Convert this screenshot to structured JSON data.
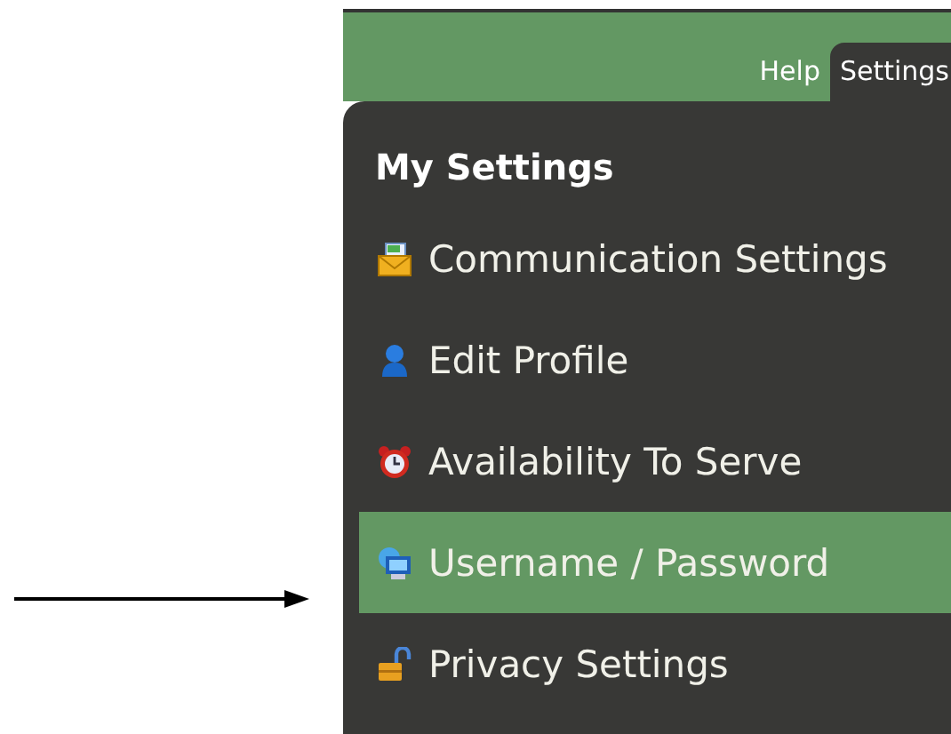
{
  "tabs": [
    {
      "label": "Help",
      "selected": false
    },
    {
      "label": "Settings",
      "selected": true
    }
  ],
  "menu": {
    "title": "My Settings",
    "items": [
      {
        "label": "Communication Settings",
        "selected": false
      },
      {
        "label": "Edit Profile",
        "selected": false
      },
      {
        "label": "Availability To Serve",
        "selected": false
      },
      {
        "label": "Username / Password",
        "selected": true
      },
      {
        "label": "Privacy Settings",
        "selected": false
      }
    ]
  }
}
